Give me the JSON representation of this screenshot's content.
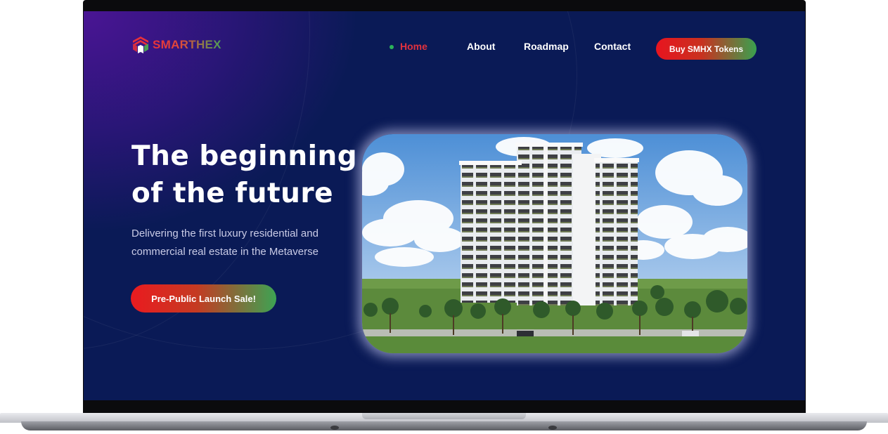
{
  "brand": {
    "name": "SMARTHEX",
    "logo_icon": "hexagon-stack-icon"
  },
  "nav": {
    "items": [
      {
        "label": "Home",
        "active": true
      },
      {
        "label": "About",
        "active": false
      },
      {
        "label": "Roadmap",
        "active": false
      },
      {
        "label": "Contact",
        "active": false
      }
    ],
    "cta_label": "Buy SMHX Tokens"
  },
  "hero": {
    "title_line1": "The beginning",
    "title_line2": "of the future",
    "subtitle_line1": "Delivering the first luxury residential and",
    "subtitle_line2": "commercial real estate in the Metaverse",
    "cta_label": "Pre-Public Launch Sale!"
  },
  "colors": {
    "brand_red": "#e8141f",
    "brand_green": "#3da353",
    "background_navy": "#0a1a56",
    "background_purple": "#4a1594",
    "active_nav": "#e2323e"
  }
}
